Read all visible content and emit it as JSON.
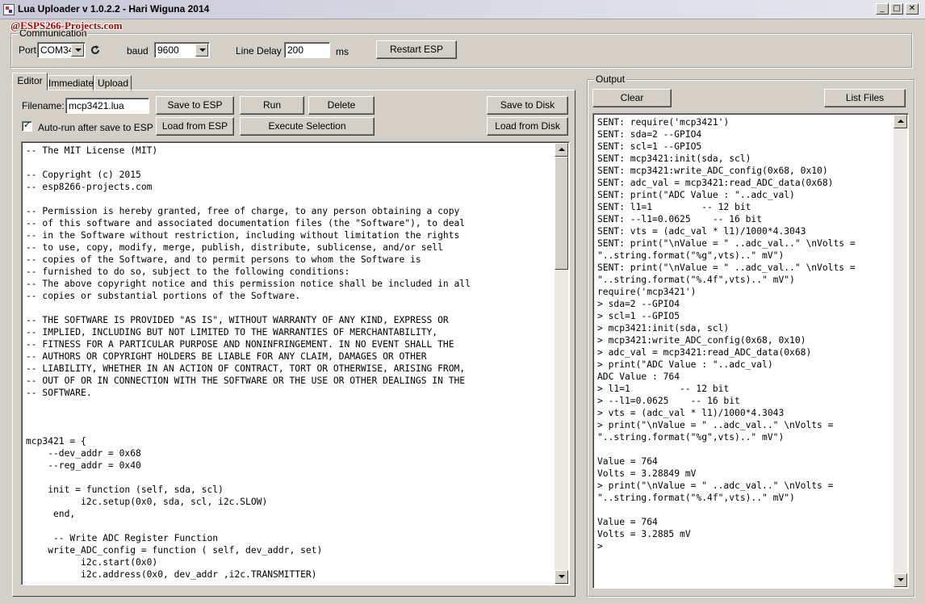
{
  "window": {
    "title": "Lua Uploader v 1.0.2.2 - Hari Wiguna 2014",
    "brand_overlay": "@ESPS266-Projects.com",
    "buttons": {
      "minimize": "_",
      "maximize": "□",
      "close": "✕"
    }
  },
  "communication": {
    "group_label": "Communication",
    "port_label": "Port",
    "port_value": "COM34",
    "baud_label": "baud",
    "baud_value": "9600",
    "line_delay_label": "Line Delay",
    "line_delay_value": "200",
    "line_delay_unit": "ms",
    "restart_button": "Restart ESP"
  },
  "tabs": [
    {
      "label": "Editor",
      "active": true
    },
    {
      "label": "Immediate",
      "active": false
    },
    {
      "label": "Upload",
      "active": false
    }
  ],
  "editor": {
    "filename_label": "Filename:",
    "filename_value": "mcp3421.lua",
    "save_to_esp": "Save to ESP",
    "run": "Run",
    "delete": "Delete",
    "save_to_disk": "Save to Disk",
    "autorun_label": "Auto-run after save to ESP",
    "autorun_checked": true,
    "load_from_esp": "Load from ESP",
    "execute_selection": "Execute Selection",
    "load_from_disk": "Load from Disk",
    "code_lines": [
      "-- The MIT License (MIT)",
      "",
      "-- Copyright (c) 2015",
      "-- esp8266-projects.com",
      "",
      "-- Permission is hereby granted, free of charge, to any person obtaining a copy",
      "-- of this software and associated documentation files (the \"Software\"), to deal",
      "-- in the Software without restriction, including without limitation the rights",
      "-- to use, copy, modify, merge, publish, distribute, sublicense, and/or sell",
      "-- copies of the Software, and to permit persons to whom the Software is",
      "-- furnished to do so, subject to the following conditions:",
      "-- The above copyright notice and this permission notice shall be included in all",
      "-- copies or substantial portions of the Software.",
      "",
      "-- THE SOFTWARE IS PROVIDED \"AS IS\", WITHOUT WARRANTY OF ANY KIND, EXPRESS OR",
      "-- IMPLIED, INCLUDING BUT NOT LIMITED TO THE WARRANTIES OF MERCHANTABILITY,",
      "-- FITNESS FOR A PARTICULAR PURPOSE AND NONINFRINGEMENT. IN NO EVENT SHALL THE",
      "-- AUTHORS OR COPYRIGHT HOLDERS BE LIABLE FOR ANY CLAIM, DAMAGES OR OTHER",
      "-- LIABILITY, WHETHER IN AN ACTION OF CONTRACT, TORT OR OTHERWISE, ARISING FROM,",
      "-- OUT OF OR IN CONNECTION WITH THE SOFTWARE OR THE USE OR OTHER DEALINGS IN THE",
      "-- SOFTWARE.",
      "",
      "",
      "",
      "mcp3421 = {",
      "    --dev_addr = 0x68",
      "    --reg_addr = 0x40",
      "",
      "    init = function (self, sda, scl)",
      "          i2c.setup(0x0, sda, scl, i2c.SLOW)",
      "     end,",
      "",
      "     -- Write ADC Register Function",
      "    write_ADC_config = function ( self, dev_addr, set)",
      "          i2c.start(0x0)",
      "          i2c.address(0x0, dev_addr ,i2c.TRANSMITTER)"
    ]
  },
  "output": {
    "group_label": "Output",
    "clear_button": "Clear",
    "list_files_button": "List Files",
    "lines": [
      "SENT: require('mcp3421')",
      "SENT: sda=2 --GPIO4",
      "SENT: scl=1 --GPIO5",
      "SENT: mcp3421:init(sda, scl)",
      "SENT: mcp3421:write_ADC_config(0x68, 0x10)",
      "SENT: adc_val = mcp3421:read_ADC_data(0x68)",
      "SENT: print(\"ADC Value : \"..adc_val)",
      "SENT: l1=1         -- 12 bit",
      "SENT: --l1=0.0625    -- 16 bit",
      "SENT: vts = (adc_val * l1)/1000*4.3043",
      "SENT: print(\"\\nValue = \" ..adc_val..\" \\nVolts =",
      "\"..string.format(\"%g\",vts)..\" mV\")",
      "SENT: print(\"\\nValue = \" ..adc_val..\" \\nVolts =",
      "\"..string.format(\"%.4f\",vts)..\" mV\")",
      "require('mcp3421')",
      "> sda=2 --GPIO4",
      "> scl=1 --GPIO5",
      "> mcp3421:init(sda, scl)",
      "> mcp3421:write_ADC_config(0x68, 0x10)",
      "> adc_val = mcp3421:read_ADC_data(0x68)",
      "> print(\"ADC Value : \"..adc_val)",
      "ADC Value : 764",
      "> l1=1         -- 12 bit",
      "> --l1=0.0625    -- 16 bit",
      "> vts = (adc_val * l1)/1000*4.3043",
      "> print(\"\\nValue = \" ..adc_val..\" \\nVolts =",
      "\"..string.format(\"%g\",vts)..\" mV\")",
      "",
      "Value = 764",
      "Volts = 3.28849 mV",
      "> print(\"\\nValue = \" ..adc_val..\" \\nVolts =",
      "\"..string.format(\"%.4f\",vts)..\" mV\")",
      "",
      "Value = 764",
      "Volts = 3.2885 mV",
      ">"
    ]
  }
}
